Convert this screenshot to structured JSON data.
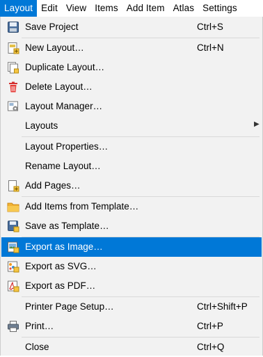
{
  "menubar": {
    "items": [
      {
        "label": "Layout",
        "active": true
      },
      {
        "label": "Edit"
      },
      {
        "label": "View"
      },
      {
        "label": "Items"
      },
      {
        "label": "Add Item"
      },
      {
        "label": "Atlas"
      },
      {
        "label": "Settings"
      }
    ]
  },
  "menu": {
    "items": [
      {
        "label": "Save Project",
        "shortcut": "Ctrl+S",
        "icon": "save-icon"
      },
      {
        "label": "New Layout…",
        "shortcut": "Ctrl+N",
        "icon": "new-layout-icon"
      },
      {
        "label": "Duplicate Layout…",
        "icon": "duplicate-layout-icon"
      },
      {
        "label": "Delete Layout…",
        "icon": "delete-icon"
      },
      {
        "label": "Layout Manager…",
        "icon": "layout-manager-icon"
      },
      {
        "label": "Layouts",
        "submenu": true
      },
      {
        "label": "Layout Properties…"
      },
      {
        "label": "Rename Layout…"
      },
      {
        "label": "Add Pages…",
        "icon": "add-pages-icon"
      },
      {
        "label": "Add Items from Template…",
        "icon": "folder-icon"
      },
      {
        "label": "Save as Template…",
        "icon": "save-template-icon"
      },
      {
        "label": "Export as Image…",
        "icon": "export-image-icon",
        "highlighted": true
      },
      {
        "label": "Export as SVG…",
        "icon": "export-svg-icon"
      },
      {
        "label": "Export as PDF…",
        "icon": "export-pdf-icon"
      },
      {
        "label": "Printer Page Setup…",
        "shortcut": "Ctrl+Shift+P"
      },
      {
        "label": "Print…",
        "shortcut": "Ctrl+P",
        "icon": "printer-icon"
      },
      {
        "label": "Close",
        "shortcut": "Ctrl+Q"
      }
    ]
  },
  "colors": {
    "highlight": "#0078d7",
    "menu_bg": "#f2f2f2"
  }
}
